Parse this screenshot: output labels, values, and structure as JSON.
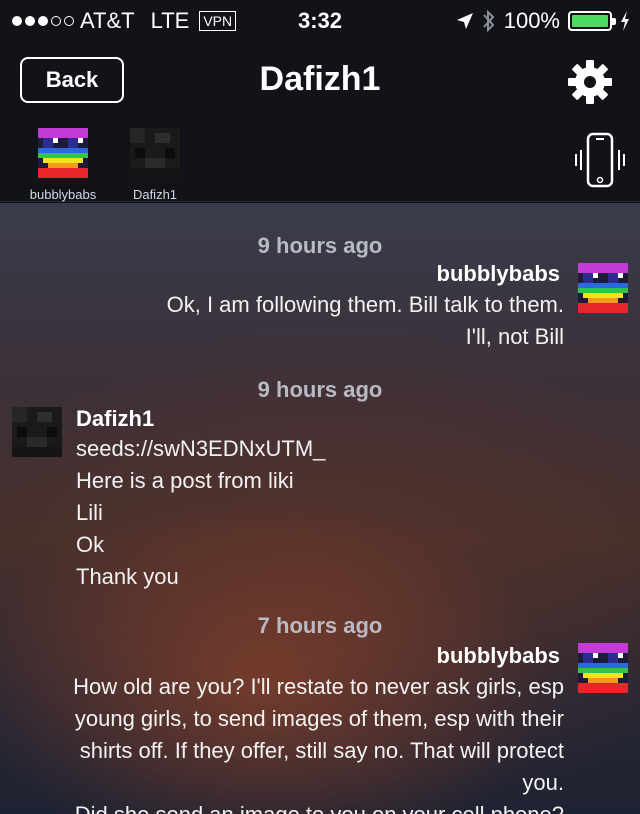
{
  "status_bar": {
    "carrier": "AT&T",
    "network": "LTE",
    "vpn": "VPN",
    "time": "3:32",
    "battery": "100%",
    "signal_bars_filled": 3,
    "signal_bars_total": 5
  },
  "nav": {
    "back_label": "Back",
    "title": "Dafizh1"
  },
  "participants": [
    {
      "name": "bubblybabs",
      "avatar": "rainbow-pixel-avatar"
    },
    {
      "name": "Dafizh1",
      "avatar": "dark-pixel-avatar"
    }
  ],
  "icons": {
    "settings": "gear-icon",
    "vibrate": "phone-vibrate-icon",
    "location": "location-arrow-icon",
    "bluetooth": "bluetooth-icon"
  },
  "messages": [
    {
      "timestamp": "9 hours ago",
      "sender": "bubblybabs",
      "align": "right",
      "lines": [
        "Ok, I am following them. Bill talk to them.",
        "I'll, not Bill"
      ]
    },
    {
      "timestamp": "9 hours ago",
      "sender": "Dafizh1",
      "align": "left",
      "lines": [
        "seeds://swN3EDNxUTM_",
        "Here is a post from liki",
        "Lili",
        "Ok",
        "Thank you"
      ]
    },
    {
      "timestamp": "7 hours ago",
      "sender": "bubblybabs",
      "align": "right",
      "lines": [
        "How old are you?  I'll restate to never ask girls, esp",
        "young girls, to send images of them, esp with their",
        "shirts off.  If they offer, still say no.  That will protect",
        "you.",
        "Did she send an image to you on your cell phone?"
      ]
    }
  ],
  "colors": {
    "battery": "#4cd964",
    "timestamp": "#b8bac4",
    "topbar": "#111319"
  }
}
